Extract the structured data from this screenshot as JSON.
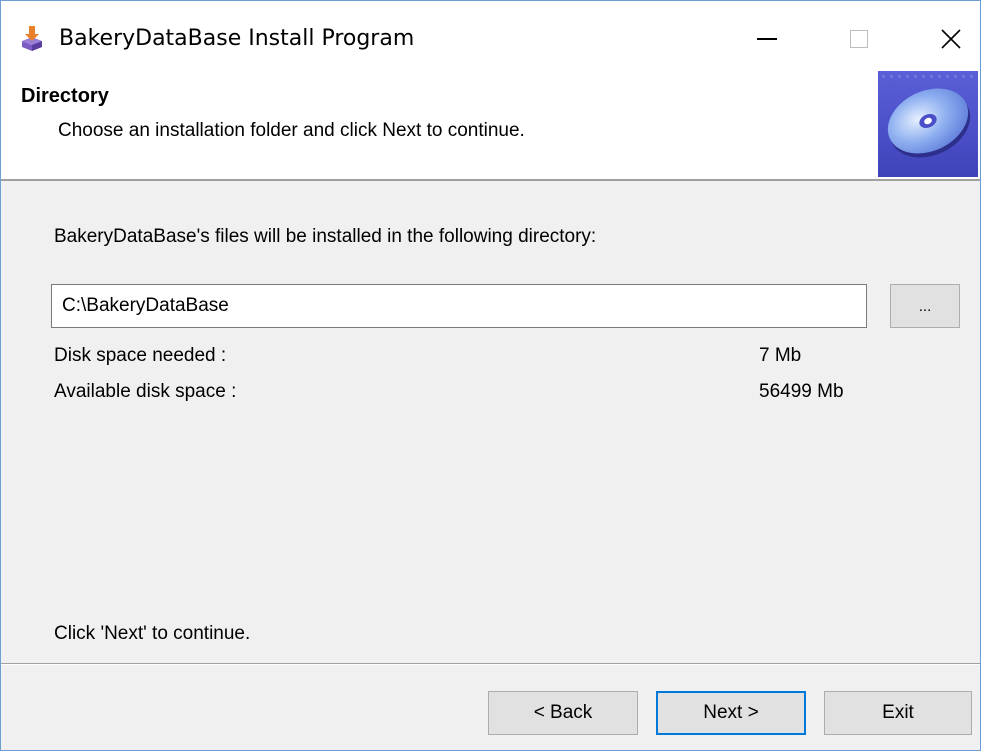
{
  "window": {
    "title": "BakeryDataBase Install Program",
    "accent_color": "#0078d7",
    "icons": {
      "app": "installer-package-icon",
      "minimize": "minimize-icon",
      "maximize": "maximize-icon",
      "close": "close-icon"
    }
  },
  "header": {
    "title": "Directory",
    "subtitle": "Choose an installation folder and click Next to continue.",
    "image": "cd-disc-icon"
  },
  "body": {
    "intro": "BakeryDataBase's files will be installed in the following directory:",
    "path_value": "C:\\BakeryDataBase",
    "browse_label": "...",
    "disk_needed_label": "Disk space needed :",
    "disk_needed_value": "7 Mb",
    "disk_available_label": "Available disk space :",
    "disk_available_value": "56499 Mb",
    "continue_hint": "Click 'Next' to continue."
  },
  "footer": {
    "back_label": "< Back",
    "next_label": "Next >",
    "exit_label": "Exit"
  }
}
